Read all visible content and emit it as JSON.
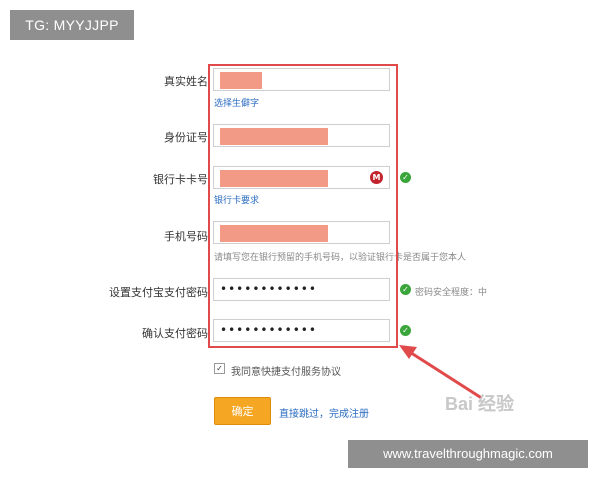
{
  "overlay": {
    "tg_badge": "TG: MYYJJPP",
    "watermark": "Bai  经验",
    "url_banner": "www.travelthroughmagic.com"
  },
  "form": {
    "real_name": {
      "label": "真实姓名",
      "hint": "选择生僻字"
    },
    "id_number": {
      "label": "身份证号"
    },
    "bank_card": {
      "label": "银行卡卡号",
      "hint": "银行卡要求",
      "bank_icon_text": "M"
    },
    "phone": {
      "label": "手机号码",
      "hint": "请填写您在银行预留的手机号码，以验证银行卡是否属于您本人"
    },
    "set_password": {
      "label": "设置支付宝支付密码",
      "value": "••••••••••••",
      "strength_text": "密码安全程度：中"
    },
    "confirm_password": {
      "label": "确认支付密码",
      "value": "••••••••••••"
    },
    "agreement_text": "我同意快捷支付服务协议",
    "agreement_checked": "✓",
    "confirm_button": "确定",
    "skip_link": "直接跳过，完成注册"
  },
  "icons": {
    "check": "✓"
  },
  "colors": {
    "highlight_border": "#e04a4a",
    "redaction": "#f39a87",
    "confirm_button": "#f5a623",
    "link": "#2a6cc0",
    "check_icon": "#3aa53a"
  }
}
